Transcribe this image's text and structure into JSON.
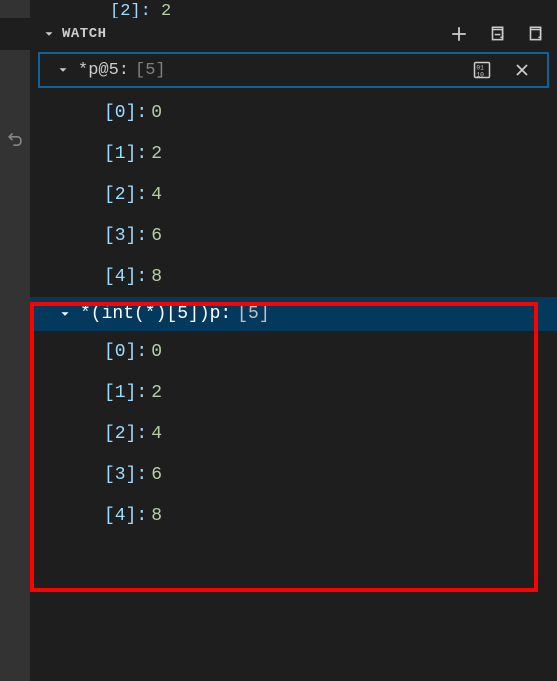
{
  "top_fragment": {
    "index": "[2]:",
    "value": "2"
  },
  "section": {
    "title": "WATCH"
  },
  "watch1": {
    "expr": "*p@5:",
    "summary": "[5]",
    "items": [
      {
        "index": "[0]:",
        "value": "0"
      },
      {
        "index": "[1]:",
        "value": "2"
      },
      {
        "index": "[2]:",
        "value": "4"
      },
      {
        "index": "[3]:",
        "value": "6"
      },
      {
        "index": "[4]:",
        "value": "8"
      }
    ]
  },
  "watch2": {
    "expr": "*(int(*)[5])p:",
    "summary": "[5]",
    "items": [
      {
        "index": "[0]:",
        "value": "0"
      },
      {
        "index": "[1]:",
        "value": "2"
      },
      {
        "index": "[2]:",
        "value": "4"
      },
      {
        "index": "[3]:",
        "value": "6"
      },
      {
        "index": "[4]:",
        "value": "8"
      }
    ]
  }
}
